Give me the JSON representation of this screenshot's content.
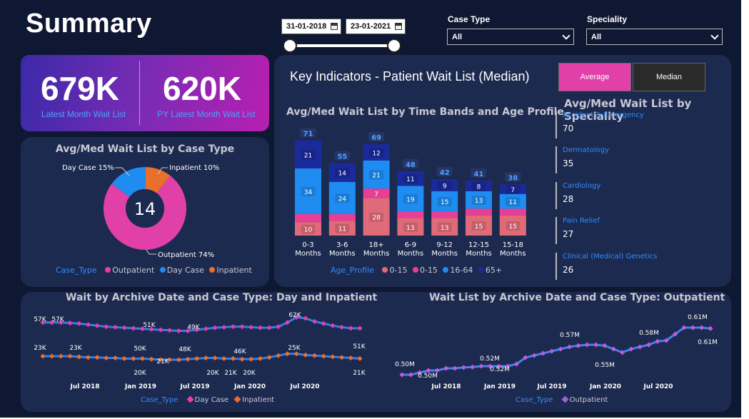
{
  "page": {
    "title": "Summary",
    "date_start": "31-01-2018",
    "date_end": "23-01-2021",
    "filters": [
      {
        "label": "Case Type",
        "value": "All"
      },
      {
        "label": "Speciality",
        "value": "All"
      }
    ]
  },
  "kpis": [
    {
      "value": "679K",
      "label": "Latest Month Wait List"
    },
    {
      "value": "620K",
      "label": "PY Latest Month Wait List"
    }
  ],
  "key_indicators": {
    "title": "Key Indicators - Patient Wait List (Median)",
    "toggle": [
      {
        "label": "Average",
        "active": true
      },
      {
        "label": "Median",
        "active": false
      }
    ]
  },
  "colors": {
    "outpatient": "#e040a8",
    "day_case": "#1e8cf0",
    "inpatient": "#e8702a",
    "age_0_15a": "#e06b78",
    "age_0_15b": "#e83f95",
    "age_16_64": "#1e8cf0",
    "age_65": "#1b2a9a"
  },
  "chart_data": [
    {
      "type": "pie",
      "title": "Avg/Med Wait List by Case Type",
      "center_value": "14",
      "slices": [
        {
          "name": "Outpatient",
          "value": 74,
          "label": "Outpatient 74%"
        },
        {
          "name": "Day Case",
          "value": 15,
          "label": "Day Case 15%"
        },
        {
          "name": "Inpatient",
          "value": 10,
          "label": "Inpatient 10%"
        }
      ],
      "legend_title": "Case_Type",
      "legend": [
        "Outpatient",
        "Day Case",
        "Inpatient"
      ]
    },
    {
      "type": "bar",
      "stacked": true,
      "title": "Avg/Med Wait List by Time Bands and Age Profile",
      "categories": [
        "0-3 Months",
        "3-6 Months",
        "18+ Months",
        "6-9 Months",
        "9-12 Months",
        "12-15 Months",
        "15-18 Months"
      ],
      "category_lines": [
        [
          "0-3",
          "Months"
        ],
        [
          "3-6",
          "Months"
        ],
        [
          "18+",
          "Months"
        ],
        [
          "6-9",
          "Months"
        ],
        [
          "9-12",
          "Months"
        ],
        [
          "12-15",
          "Months"
        ],
        [
          "15-18",
          "Months"
        ]
      ],
      "totals": [
        71,
        55,
        69,
        48,
        42,
        41,
        38
      ],
      "series": [
        {
          "name": "0-15",
          "values": [
            10,
            11,
            28,
            13,
            13,
            15,
            15
          ],
          "show_labels": true
        },
        {
          "name": "0-15",
          "values": [
            6,
            5,
            7,
            5,
            5,
            5,
            5
          ],
          "show_labels": false,
          "labels": [
            "",
            "",
            "7",
            "",
            "",
            "",
            ""
          ]
        },
        {
          "name": "16-64",
          "values": [
            34,
            24,
            21,
            19,
            15,
            13,
            11
          ],
          "show_labels": true
        },
        {
          "name": "65+",
          "values": [
            21,
            14,
            12,
            11,
            9,
            8,
            7
          ],
          "show_labels": true
        }
      ],
      "legend_title": "Age_Profile",
      "legend": [
        "0-15",
        "0-15",
        "16-64",
        "65+"
      ]
    },
    {
      "type": "table",
      "title": "Avg/Med Wait List by Speciality",
      "rows": [
        {
          "name": "Accident & Emergency",
          "value": "70"
        },
        {
          "name": "Dermatology",
          "value": "35"
        },
        {
          "name": "Cardiology",
          "value": "28"
        },
        {
          "name": "Pain Relief",
          "value": "27"
        },
        {
          "name": "Clinical (Medical) Genetics",
          "value": "26"
        }
      ]
    },
    {
      "type": "line",
      "title": "Wait by Archive Date and Case Type: Day and Inpatient",
      "x_ticks": [
        "Jul 2018",
        "Jan 2019",
        "Jul 2019",
        "Jan 2020",
        "Jul 2020"
      ],
      "series": [
        {
          "name": "Day Case",
          "values": [
            57,
            57,
            57,
            56.5,
            56,
            55,
            54,
            53,
            52.5,
            52,
            51.5,
            51,
            50.5,
            50,
            49.5,
            49,
            49,
            50,
            51,
            52,
            52.5,
            53,
            53,
            52.5,
            52,
            52,
            53,
            57,
            62,
            61,
            58,
            56,
            54,
            52.5,
            51.5,
            51.5
          ]
        },
        {
          "name": "Inpatient",
          "values": [
            23,
            23,
            23,
            23,
            22.5,
            22,
            22,
            21.5,
            21.5,
            21,
            21,
            21,
            20.5,
            20,
            20,
            20,
            20.5,
            21,
            21.5,
            21.5,
            21,
            21,
            20.5,
            20.5,
            21,
            22,
            23.5,
            25,
            25,
            24,
            23.5,
            23,
            22.5,
            22,
            21.5,
            21
          ]
        }
      ],
      "labels_top": [
        "57K",
        "57K",
        "51K",
        "49K",
        "62K",
        "51K"
      ],
      "labels_bottom": [
        "23K",
        "23K",
        "50K",
        "21K",
        "48K",
        "20K",
        "46K",
        "20K",
        "21K",
        "20K",
        "25K",
        "21K"
      ],
      "legend_title": "Case_Type",
      "legend": [
        "Day Case",
        "Inpatient"
      ]
    },
    {
      "type": "line",
      "title": "Wait List by Archive Date and Case Type: Outpatient",
      "x_ticks": [
        "Jul 2018",
        "Jan 2019",
        "Jul 2019",
        "Jan 2020",
        "Jul 2020"
      ],
      "series": [
        {
          "name": "Outpatient",
          "values": [
            0.5,
            0.5,
            0.505,
            0.51,
            0.51,
            0.515,
            0.515,
            0.517,
            0.518,
            0.52,
            0.52,
            0.52,
            0.52,
            0.525,
            0.54,
            0.545,
            0.55,
            0.555,
            0.56,
            0.565,
            0.568,
            0.57,
            0.57,
            0.568,
            0.56,
            0.552,
            0.56,
            0.565,
            0.57,
            0.578,
            0.58,
            0.595,
            0.61,
            0.61,
            0.61,
            0.608
          ]
        }
      ],
      "labels": [
        "0.50M",
        "0.50M",
        "0.52M",
        "0.52M",
        "0.57M",
        "0.55M",
        "0.58M",
        "0.61M",
        "0.61M"
      ],
      "legend_title": "Case_Type",
      "legend": [
        "Outpatient"
      ]
    }
  ]
}
